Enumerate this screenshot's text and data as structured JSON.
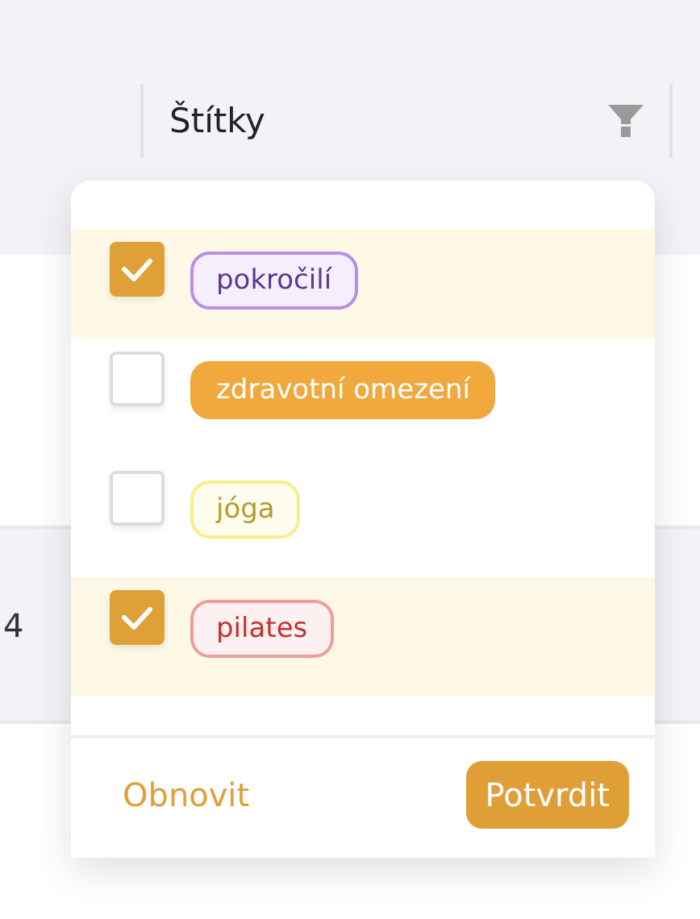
{
  "table": {
    "columns": [
      {
        "label": "Štítky"
      }
    ],
    "rows": [
      {
        "cells": []
      },
      {
        "cells": [
          "4"
        ]
      }
    ]
  },
  "filter_popup": {
    "options": [
      {
        "checked": true,
        "tag": {
          "label": "pokročilí",
          "kind": "outline",
          "color": "#b98ee8"
        }
      },
      {
        "checked": false,
        "tag": {
          "label": "zdravotní omezení",
          "kind": "filled",
          "color": "#f1a83c"
        }
      },
      {
        "checked": false,
        "tag": {
          "label": "jóga",
          "kind": "outline",
          "color": "#f8ee8a"
        }
      },
      {
        "checked": true,
        "tag": {
          "label": "pilates",
          "kind": "outline",
          "color": "#ef9c9c"
        }
      }
    ],
    "reset_label": "Obnovit",
    "confirm_label": "Potvrdit"
  }
}
